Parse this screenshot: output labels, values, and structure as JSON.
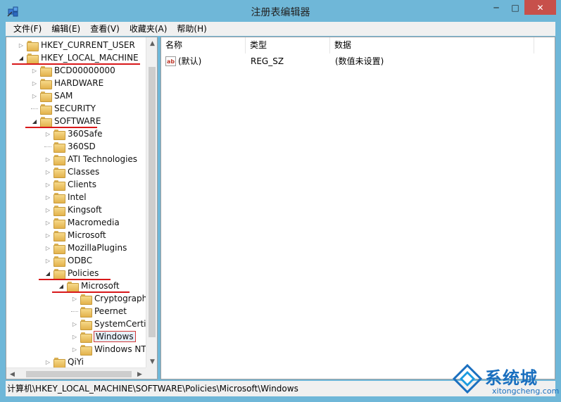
{
  "window": {
    "title": "注册表编辑器",
    "min_glyph": "─",
    "max_glyph": "□",
    "close_glyph": "✕"
  },
  "menu": [
    "文件(F)",
    "编辑(E)",
    "查看(V)",
    "收藏夹(A)",
    "帮助(H)"
  ],
  "tree": {
    "items": [
      {
        "label": "HKEY_CURRENT_USER",
        "level": 0,
        "expanded": false
      },
      {
        "label": "HKEY_LOCAL_MACHINE",
        "level": 0,
        "expanded": true,
        "highlight": "underline"
      },
      {
        "label": "BCD00000000",
        "level": 1,
        "expanded": false
      },
      {
        "label": "HARDWARE",
        "level": 1,
        "expanded": false
      },
      {
        "label": "SAM",
        "level": 1,
        "expanded": false
      },
      {
        "label": "SECURITY",
        "level": 1,
        "expanded": null
      },
      {
        "label": "SOFTWARE",
        "level": 1,
        "expanded": true,
        "highlight": "underline"
      },
      {
        "label": "360Safe",
        "level": 2,
        "expanded": false
      },
      {
        "label": "360SD",
        "level": 2,
        "expanded": null
      },
      {
        "label": "ATI Technologies",
        "level": 2,
        "expanded": false
      },
      {
        "label": "Classes",
        "level": 2,
        "expanded": false
      },
      {
        "label": "Clients",
        "level": 2,
        "expanded": false
      },
      {
        "label": "Intel",
        "level": 2,
        "expanded": false
      },
      {
        "label": "Kingsoft",
        "level": 2,
        "expanded": false
      },
      {
        "label": "Macromedia",
        "level": 2,
        "expanded": false
      },
      {
        "label": "Microsoft",
        "level": 2,
        "expanded": false
      },
      {
        "label": "MozillaPlugins",
        "level": 2,
        "expanded": false
      },
      {
        "label": "ODBC",
        "level": 2,
        "expanded": false
      },
      {
        "label": "Policies",
        "level": 2,
        "expanded": true,
        "highlight": "underline"
      },
      {
        "label": "Microsoft",
        "level": 3,
        "expanded": true,
        "highlight": "underline"
      },
      {
        "label": "Cryptograph",
        "level": 4,
        "expanded": false
      },
      {
        "label": "Peernet",
        "level": 4,
        "expanded": null
      },
      {
        "label": "SystemCertif",
        "level": 4,
        "expanded": false
      },
      {
        "label": "Windows",
        "level": 4,
        "expanded": false,
        "highlight": "box"
      },
      {
        "label": "Windows NT",
        "level": 4,
        "expanded": false
      },
      {
        "label": "QiYi",
        "level": 2,
        "expanded": false
      }
    ]
  },
  "list": {
    "columns": [
      "名称",
      "类型",
      "数据"
    ],
    "rows": [
      {
        "name": "(默认)",
        "type": "REG_SZ",
        "data": "(数值未设置)",
        "icon": "string-value-icon",
        "icon_text": "ab"
      }
    ]
  },
  "status": {
    "path": "计算机\\HKEY_LOCAL_MACHINE\\SOFTWARE\\Policies\\Microsoft\\Windows"
  },
  "watermark": {
    "text": "系统城",
    "sub": "xitongcheng.com"
  },
  "colors": {
    "frame": "#6fb7d8",
    "close_button": "#c7504b",
    "highlight_red": "#d8181a",
    "watermark_blue": "#1a6fbf"
  }
}
